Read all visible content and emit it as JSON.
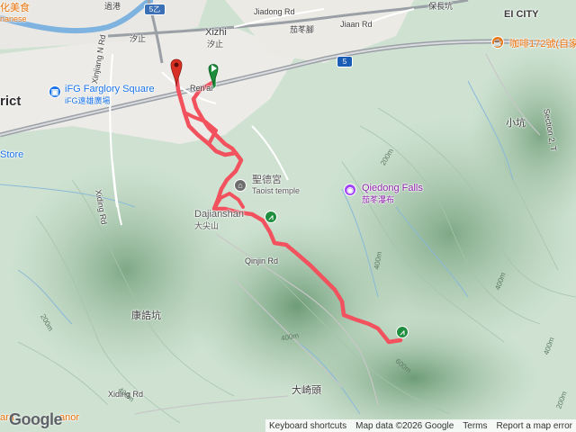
{
  "map": {
    "districts": {
      "xizhi_en": "Xizhi",
      "xizhi_zh_left": "汐止",
      "xizhi_zh": "汐止",
      "city": "EI CITY",
      "district_left": "rict"
    },
    "roads": {
      "jiadong": "Jiadong Rd",
      "jiayin": "Jiaan Rd",
      "jiadong_zh": "茄苳腳",
      "xinjiang": "Xinjiang N Rd",
      "xiding": "Xiding Rd",
      "xiding2": "Xiding Rd",
      "ren_ai": "Ren'ai",
      "qinjin": "Qinjin Rd",
      "section": "Section 2, T",
      "top_road": "過港",
      "top_right": "保長坑"
    },
    "pois": {
      "ifg_en": "iFG Farglory Square",
      "ifg_zh": "iFG遠雄廣場",
      "store": "Store",
      "temple_zh": "聖德宮",
      "temple_en": "Taoist temple",
      "falls_en": "Qiedong Falls",
      "falls_zh": "茄苳瀑布",
      "peak_en": "Dajianshan",
      "peak_zh": "大尖山",
      "cafe": "咖啡172號(自家",
      "top_left_poi": "化美食",
      "top_left_poi2": "nanese",
      "bottom_left_poi": "ara",
      "bottom_left_poi2": "anor"
    },
    "places": {
      "kang_gao_keng": "康誥坑",
      "xiao_keng": "小坑",
      "da_qi_tou": "大崎頭"
    },
    "highway_shields": [
      "5",
      "5乙"
    ],
    "contours": [
      "200m",
      "400m",
      "400m",
      "400m",
      "200m",
      "600m",
      "400m",
      "200m",
      "400m"
    ],
    "route": {
      "color": "#f2515e",
      "start_marker_color": "#1e8e3e",
      "end_marker_color": "#d93025"
    },
    "attribution": {
      "shortcuts": "Keyboard shortcuts",
      "data": "Map data ©2026 Google",
      "terms": "Terms",
      "report": "Report a map error"
    },
    "logo": "Google"
  }
}
